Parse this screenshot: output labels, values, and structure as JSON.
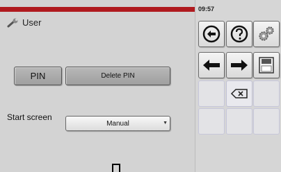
{
  "header": {
    "title": "User",
    "accent_color": "#b01a1f"
  },
  "buttons": {
    "pin": "PIN",
    "delete_pin": "Delete PIN"
  },
  "start_screen": {
    "label": "Start screen",
    "selected": "Manual"
  },
  "side_panel": {
    "clock": "09:57",
    "keys": [
      "back-circle-icon",
      "help-icon",
      "settings-gears-icon",
      "arrow-left-icon",
      "arrow-right-icon",
      "save-icon",
      "backspace-icon"
    ]
  }
}
